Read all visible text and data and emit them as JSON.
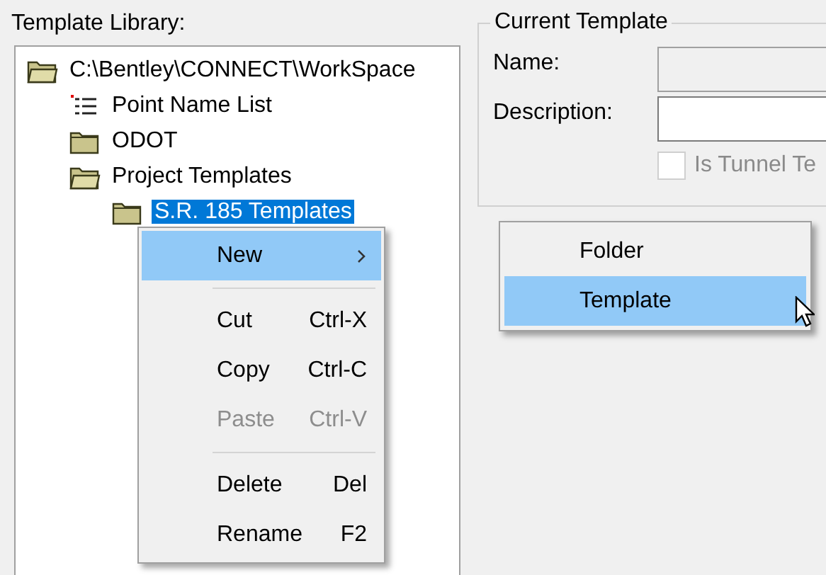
{
  "library": {
    "label": "Template Library:",
    "tree": [
      {
        "label": "C:\\Bentley\\CONNECT\\WorkSpace",
        "kind": "folder",
        "expanded": true,
        "selected": false,
        "children": [
          {
            "label": "Point Name List",
            "kind": "list",
            "selected": false
          },
          {
            "label": "ODOT",
            "kind": "folder",
            "expanded": false,
            "selected": false
          },
          {
            "label": "Project Templates",
            "kind": "folder",
            "expanded": true,
            "selected": false,
            "children": [
              {
                "label": "S.R. 185 Templates",
                "kind": "folder",
                "expanded": false,
                "selected": true
              }
            ]
          }
        ]
      }
    ]
  },
  "current_template": {
    "title": "Current Template",
    "fields": [
      {
        "label": "Name:",
        "disabled": true
      },
      {
        "label": "Description:",
        "disabled": false
      }
    ],
    "checkbox": {
      "label": "Is Tunnel Te",
      "checked": false,
      "disabled": true
    }
  },
  "context_menu": {
    "items": [
      {
        "kind": "item",
        "label": "New",
        "submenu": true,
        "selected": true,
        "disabled": false
      },
      {
        "kind": "separator"
      },
      {
        "kind": "item",
        "label": "Cut",
        "shortcut": "Ctrl-X",
        "submenu": false,
        "selected": false,
        "disabled": false
      },
      {
        "kind": "item",
        "label": "Copy",
        "shortcut": "Ctrl-C",
        "submenu": false,
        "selected": false,
        "disabled": false
      },
      {
        "kind": "item",
        "label": "Paste",
        "shortcut": "Ctrl-V",
        "submenu": false,
        "selected": false,
        "disabled": true
      },
      {
        "kind": "separator"
      },
      {
        "kind": "item",
        "label": "Delete",
        "shortcut": "Del",
        "submenu": false,
        "selected": false,
        "disabled": false
      },
      {
        "kind": "item",
        "label": "Rename",
        "shortcut": "F2",
        "submenu": false,
        "selected": false,
        "disabled": false
      }
    ]
  },
  "submenu": {
    "items": [
      {
        "label": "Folder",
        "selected": false
      },
      {
        "label": "Template",
        "selected": true
      }
    ]
  }
}
